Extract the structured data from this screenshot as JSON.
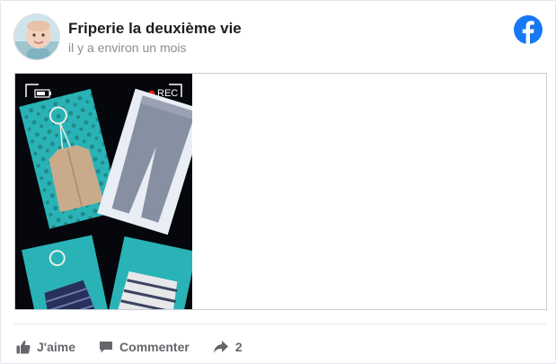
{
  "post": {
    "page_name": "Friperie la deuxième vie",
    "timestamp": "il y a environ un mois"
  },
  "media": {
    "rec_label": "REC",
    "rec_color": "#e41e1e"
  },
  "brand": {
    "facebook_color": "#1877f2",
    "muted_text": "#65676b"
  },
  "actions": {
    "like_label": "J'aime",
    "comment_label": "Commenter",
    "share_count": "2"
  },
  "icons": {
    "avatar": "baby-avatar-photo",
    "logo": "facebook-logo-icon",
    "like": "thumbs-up-icon",
    "comment": "speech-bubble-icon",
    "share": "share-arrow-icon"
  }
}
